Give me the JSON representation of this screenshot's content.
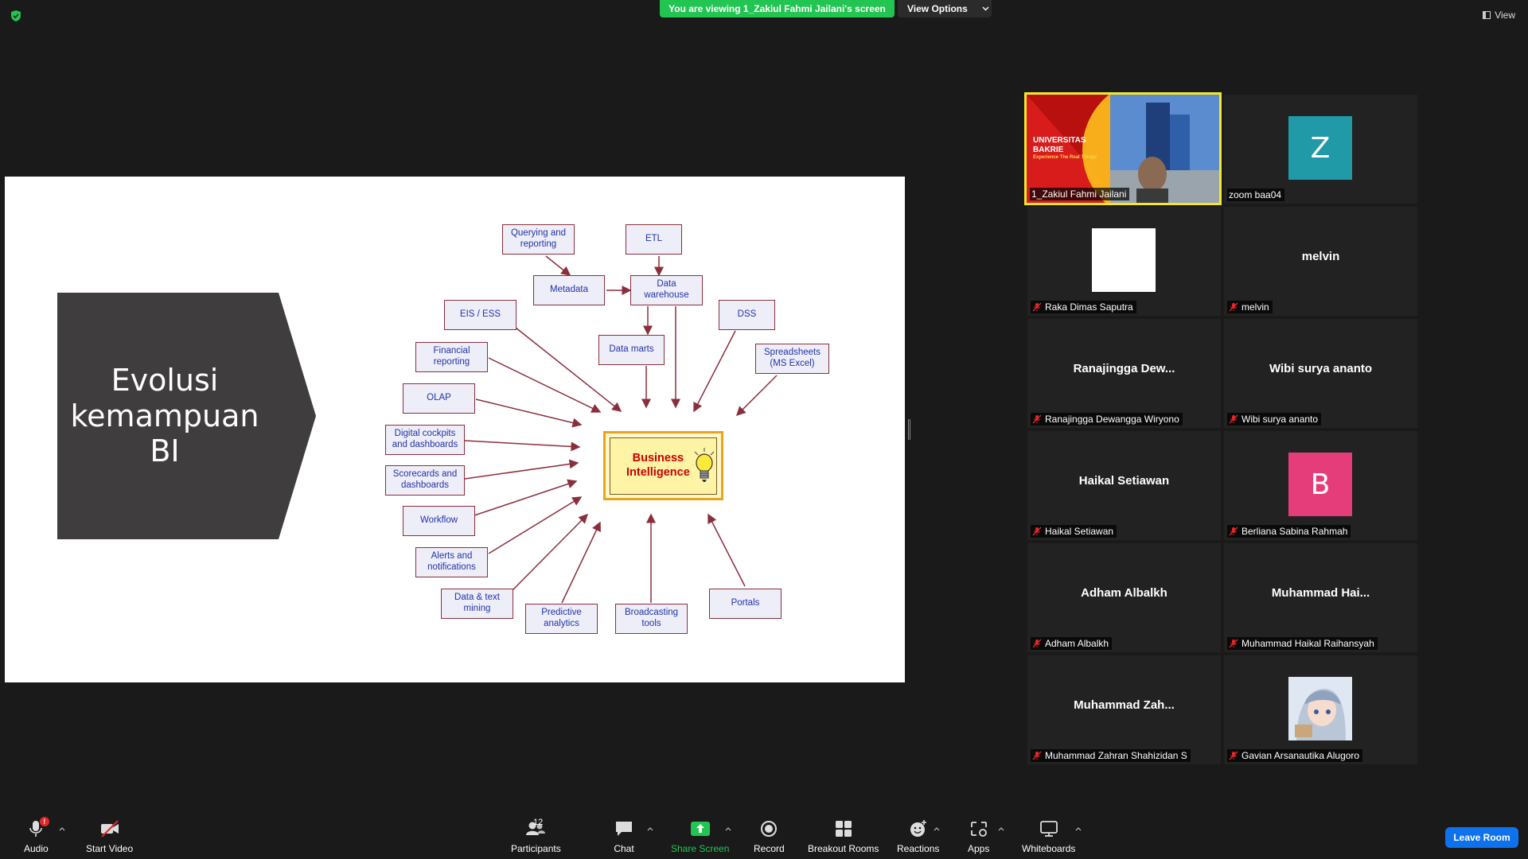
{
  "top": {
    "banner": "You are viewing 1_Zakiul Fahmi Jailani's screen",
    "view_options": "View Options",
    "view": "View"
  },
  "slide": {
    "title_line1": "Evolusi",
    "title_line2": "kemampuan",
    "title_line3": "BI",
    "center_line1": "Business",
    "center_line2": "Intelligence",
    "nodes": {
      "querying": [
        "Querying and",
        "reporting"
      ],
      "etl": "ETL",
      "metadata": "Metadata",
      "data_warehouse": [
        "Data",
        "warehouse"
      ],
      "eis": "EIS / ESS",
      "dss": "DSS",
      "financial": [
        "Financial",
        "reporting"
      ],
      "data_marts": "Data marts",
      "spreadsheets": [
        "Spreadsheets",
        "(MS Excel)"
      ],
      "olap": "OLAP",
      "digital": [
        "Digital cockpits",
        "and dashboards"
      ],
      "scorecards": [
        "Scorecards and",
        "dashboards"
      ],
      "workflow": "Workflow",
      "alerts": [
        "Alerts and",
        "notifications"
      ],
      "mining": [
        "Data & text",
        "mining"
      ],
      "predictive": [
        "Predictive",
        "analytics"
      ],
      "broadcasting": [
        "Broadcasting",
        "tools"
      ],
      "portals": "Portals"
    }
  },
  "participants": [
    {
      "id": "p1",
      "display_name": "1_Zakiul Fahmi Jailani",
      "tag": "1_Zakiul Fahmi Jailani",
      "muted": false,
      "video": true
    },
    {
      "id": "p2",
      "avatar_letter": "Z",
      "avatar_color": "#1f9aa6",
      "tag": "zoom baa04",
      "muted": false
    },
    {
      "id": "p3",
      "avatar_color": "#ffffff",
      "tag": "Raka Dimas Saputra",
      "muted": true
    },
    {
      "id": "p4",
      "center": "melvin",
      "tag": "melvin",
      "muted": true
    },
    {
      "id": "p5",
      "center": "Ranajingga  Dew...",
      "tag": "Ranajingga Dewangga Wiryono",
      "muted": true
    },
    {
      "id": "p6",
      "center": "Wibi surya ananto",
      "tag": "Wibi surya ananto",
      "muted": true
    },
    {
      "id": "p7",
      "center": "Haikal Setiawan",
      "tag": "Haikal Setiawan",
      "muted": true
    },
    {
      "id": "p8",
      "avatar_letter": "B",
      "avatar_color": "#e53c7a",
      "tag": "Berliana Sabina Rahmah",
      "muted": true
    },
    {
      "id": "p9",
      "center": "Adham Albalkh",
      "tag": "Adham Albalkh",
      "muted": true
    },
    {
      "id": "p10",
      "center": "Muhammad  Hai...",
      "tag": "Muhammad Haikal Raihansyah",
      "muted": true
    },
    {
      "id": "p11",
      "center": "Muhammad  Zah...",
      "tag": "Muhammad Zahran Shahizidan S",
      "muted": true
    },
    {
      "id": "p12",
      "avatar_image": "anime-avatar",
      "tag": "Gavian Arsanautika Alugoro",
      "muted": true
    }
  ],
  "video_overlay": {
    "line1": "UNIVERSITAS",
    "line2": "BAKRIE",
    "line3": "Experience The Real Things"
  },
  "toolbar": {
    "audio": "Audio",
    "audio_badge": "!",
    "start_video": "Start Video",
    "participants": "Participants",
    "participants_count": "12",
    "chat": "Chat",
    "share_screen": "Share Screen",
    "record": "Record",
    "breakout": "Breakout Rooms",
    "reactions": "Reactions",
    "apps": "Apps",
    "whiteboards": "Whiteboards",
    "leave": "Leave Room"
  },
  "colors": {
    "share_green": "#23c552",
    "leave_blue": "#0e72ed",
    "active_speaker": "#f4e72b",
    "arrow": "#8b2e3b"
  }
}
